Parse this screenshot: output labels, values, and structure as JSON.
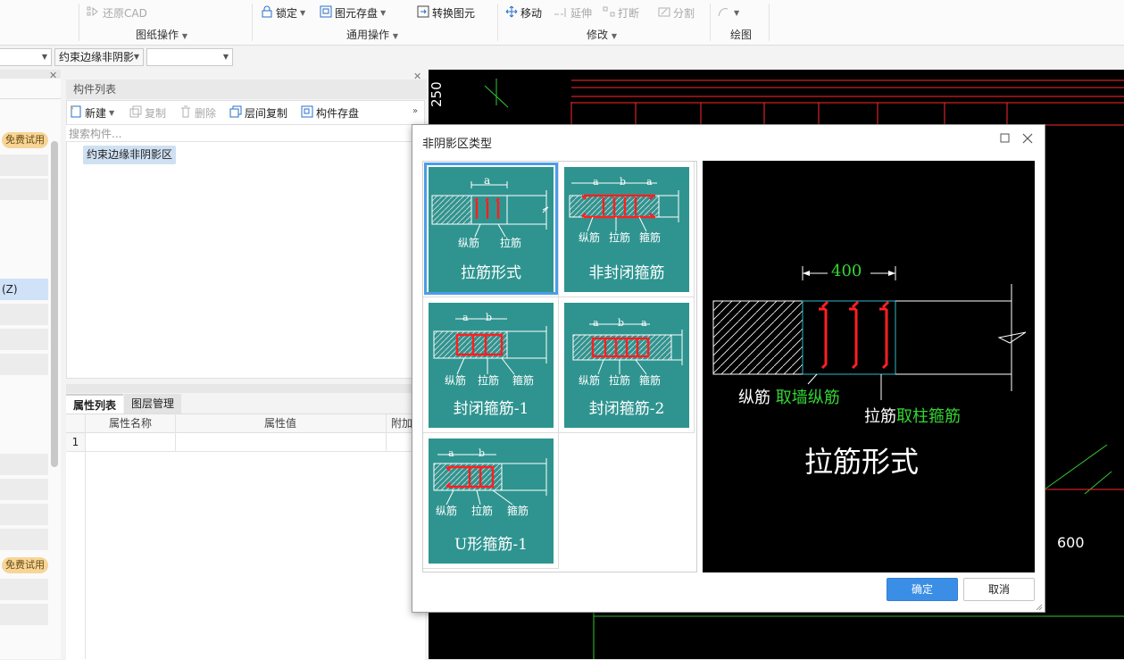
{
  "ribbon": {
    "restore_cad": "还原CAD",
    "lock": "锁定",
    "element_save": "图元存盘",
    "convert_element": "转换图元",
    "move": "移动",
    "extend": "延伸",
    "break": "打断",
    "split": "分割",
    "groups": {
      "drawing_ops": "图纸操作",
      "general_ops": "通用操作",
      "modify": "修改",
      "draw": "绘图"
    }
  },
  "row2": {
    "combo2_value": "约束边缘非阴影"
  },
  "left_panel": {
    "badge1": "免费试用",
    "selected_item": "(Z)",
    "badge2": "免费试用"
  },
  "component_list": {
    "title": "构件列表",
    "toolbar": {
      "new": "新建",
      "copy": "复制",
      "delete": "删除",
      "floor_copy": "层间复制",
      "save": "构件存盘"
    },
    "search_placeholder": "搜索构件...",
    "items": [
      "约束边缘非阴影区"
    ]
  },
  "property_panel": {
    "tabs": [
      "属性列表",
      "图层管理"
    ],
    "columns": [
      "属性名称",
      "属性值",
      "附加"
    ],
    "rows": [
      {
        "index": "1",
        "name": "",
        "value": ""
      }
    ]
  },
  "cad": {
    "dim_left": "250",
    "dim_right": "600"
  },
  "dialog": {
    "title": "非阴影区类型",
    "types": [
      {
        "name": "拉筋形式",
        "labels": [
          "纵筋",
          "拉筋"
        ],
        "dims": [
          "a"
        ],
        "selected": true
      },
      {
        "name": "非封闭箍筋",
        "labels": [
          "纵筋",
          "拉筋",
          "箍筋"
        ],
        "dims": [
          "a",
          "b",
          "a"
        ],
        "selected": false
      },
      {
        "name": "封闭箍筋-1",
        "labels": [
          "纵筋",
          "拉筋",
          "箍筋"
        ],
        "dims": [
          "a",
          "b"
        ],
        "selected": false
      },
      {
        "name": "封闭箍筋-2",
        "labels": [
          "纵筋",
          "拉筋",
          "箍筋"
        ],
        "dims": [
          "a",
          "b",
          "a"
        ],
        "selected": false
      },
      {
        "name": "U形箍筋-1",
        "labels": [
          "纵筋",
          "拉筋",
          "箍筋"
        ],
        "dims": [
          "a",
          "b"
        ],
        "selected": false
      }
    ],
    "preview": {
      "dimension": "400",
      "label1_white": "纵筋",
      "label1_green": "取墙纵筋",
      "label2_white": "拉筋",
      "label2_green": "取柱箍筋",
      "title": "拉筋形式"
    },
    "ok": "确定",
    "cancel": "取消"
  },
  "colors": {
    "teal": "#2f9490",
    "selected_border": "#4a9de6",
    "rebar_red": "#ff2020",
    "cad_green": "#33d633",
    "ok_button": "#3a8ee6"
  }
}
